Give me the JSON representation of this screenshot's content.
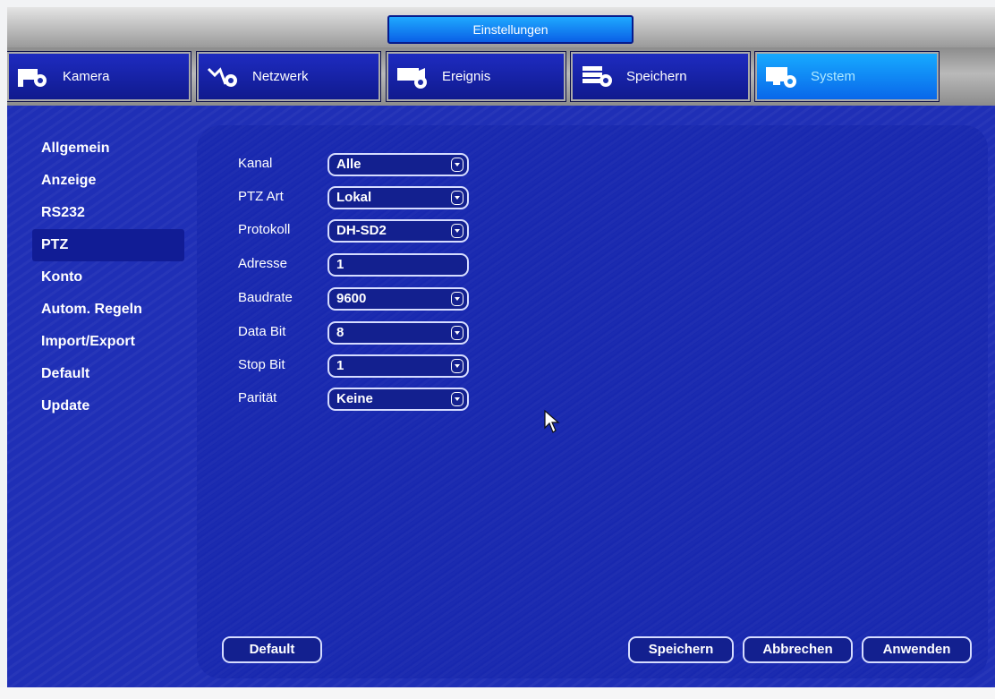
{
  "window": {
    "title": "Einstellungen"
  },
  "tabs": [
    {
      "label": "Kamera",
      "icon": "camera-settings-icon"
    },
    {
      "label": "Netzwerk",
      "icon": "network-settings-icon"
    },
    {
      "label": "Ereignis",
      "icon": "event-settings-icon"
    },
    {
      "label": "Speichern",
      "icon": "storage-settings-icon"
    },
    {
      "label": "System",
      "icon": "system-settings-icon",
      "active": true
    }
  ],
  "sidebar": {
    "items": [
      {
        "label": "Allgemein"
      },
      {
        "label": "Anzeige"
      },
      {
        "label": "RS232"
      },
      {
        "label": "PTZ",
        "active": true
      },
      {
        "label": "Konto"
      },
      {
        "label": "Autom. Regeln"
      },
      {
        "label": "Import/Export"
      },
      {
        "label": "Default"
      },
      {
        "label": "Update"
      }
    ]
  },
  "form": {
    "kanal": {
      "label": "Kanal",
      "value": "Alle"
    },
    "ptz_art": {
      "label": "PTZ Art",
      "value": "Lokal"
    },
    "protokoll": {
      "label": "Protokoll",
      "value": "DH-SD2"
    },
    "adresse": {
      "label": "Adresse",
      "value": "1"
    },
    "baudrate": {
      "label": "Baudrate",
      "value": "9600"
    },
    "data_bit": {
      "label": "Data Bit",
      "value": "8"
    },
    "stop_bit": {
      "label": "Stop Bit",
      "value": "1"
    },
    "paritaet": {
      "label": "Parität",
      "value": "Keine"
    }
  },
  "buttons": {
    "default": "Default",
    "save": "Speichern",
    "cancel": "Abbrechen",
    "apply": "Anwenden"
  },
  "colors": {
    "background": "#1f2fb6",
    "active_tab": "#0f8cff",
    "field_border": "#d6dcff"
  }
}
